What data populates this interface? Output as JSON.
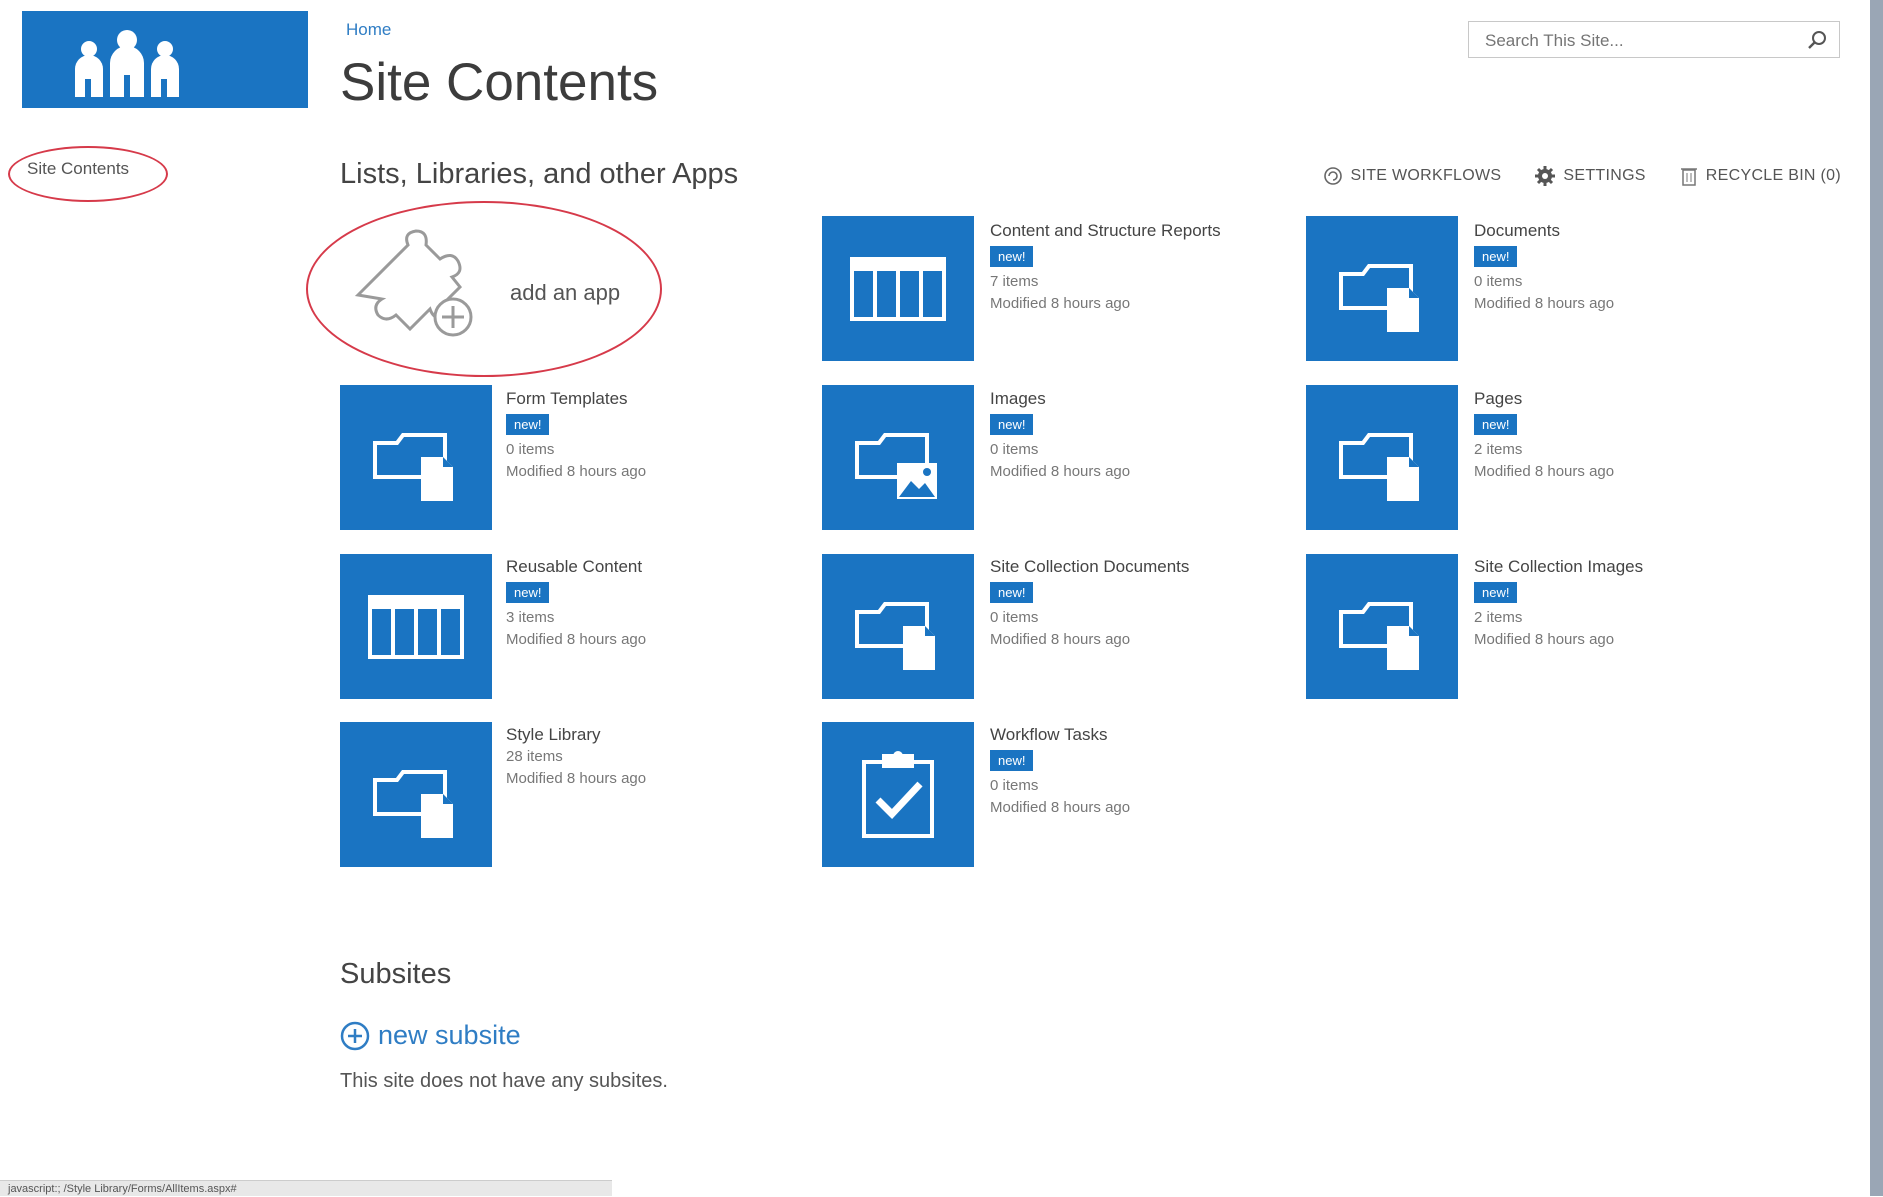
{
  "nav": {
    "site_contents": "Site Contents"
  },
  "breadcrumb": "Home",
  "page_title": "Site Contents",
  "search": {
    "placeholder": "Search This Site..."
  },
  "section_title": "Lists, Libraries, and other Apps",
  "actions": [
    {
      "label": "SITE WORKFLOWS",
      "icon": "workflow-icon"
    },
    {
      "label": "SETTINGS",
      "icon": "gear-icon"
    },
    {
      "label": "RECYCLE BIN (0)",
      "icon": "recycle-bin-icon"
    }
  ],
  "add_app": {
    "label": "add an app",
    "icon": "puzzle-plus-icon"
  },
  "apps": [
    {
      "name": "Content and Structure Reports",
      "badge": "new!",
      "count": "7 items",
      "modified": "Modified 8 hours ago",
      "icon": "list-icon"
    },
    {
      "name": "Documents",
      "badge": "new!",
      "count": "0 items",
      "modified": "Modified 8 hours ago",
      "icon": "folder-doc-icon"
    },
    {
      "name": "Form Templates",
      "badge": "new!",
      "count": "0 items",
      "modified": "Modified 8 hours ago",
      "icon": "folder-doc-icon"
    },
    {
      "name": "Images",
      "badge": "new!",
      "count": "0 items",
      "modified": "Modified 8 hours ago",
      "icon": "folder-image-icon"
    },
    {
      "name": "Pages",
      "badge": "new!",
      "count": "2 items",
      "modified": "Modified 8 hours ago",
      "icon": "folder-doc-icon"
    },
    {
      "name": "Reusable Content",
      "badge": "new!",
      "count": "3 items",
      "modified": "Modified 8 hours ago",
      "icon": "list-icon"
    },
    {
      "name": "Site Collection Documents",
      "badge": "new!",
      "count": "0 items",
      "modified": "Modified 8 hours ago",
      "icon": "folder-doc-icon"
    },
    {
      "name": "Site Collection Images",
      "badge": "new!",
      "count": "2 items",
      "modified": "Modified 8 hours ago",
      "icon": "folder-doc-icon"
    },
    {
      "name": "Style Library",
      "badge": "",
      "count": "28 items",
      "modified": "Modified 8 hours ago",
      "icon": "folder-doc-icon"
    },
    {
      "name": "Workflow Tasks",
      "badge": "new!",
      "count": "0 items",
      "modified": "Modified 8 hours ago",
      "icon": "task-check-icon"
    }
  ],
  "subsites": {
    "title": "Subsites",
    "new_label": "new subsite",
    "empty_text": "This site does not have any subsites."
  },
  "status_bar": "javascript:; /Style Library/Forms/AllItems.aspx#",
  "colors": {
    "tile": "#1a74c2",
    "link": "#2f7dc4",
    "highlight": "#d63a4a"
  }
}
